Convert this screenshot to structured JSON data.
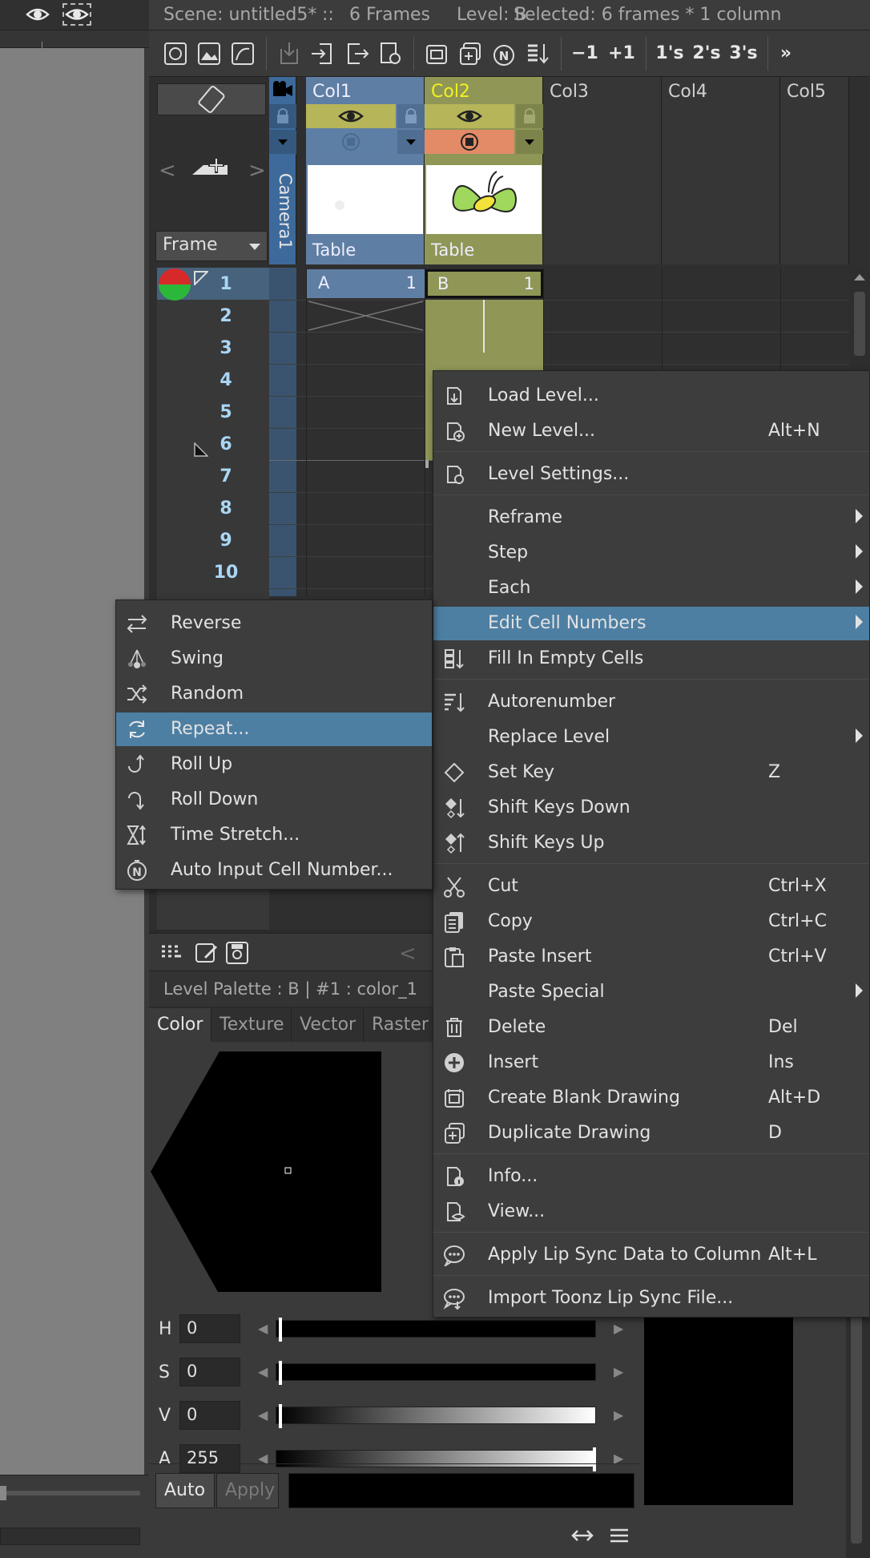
{
  "header": {
    "scene": "Scene: untitled5*",
    "sep": "::",
    "frames": "6 Frames",
    "level": "Level: B",
    "selected": "Selected: 6 frames * 1 column"
  },
  "toolbar": {
    "minus_one": "−1",
    "plus_one": "+1",
    "ones": "1's",
    "twos": "2's",
    "threes": "3's",
    "more": "»"
  },
  "xsheet": {
    "frame_dropdown": "Frame",
    "camera_label": "Camera1",
    "columns": [
      {
        "name": "Col1",
        "footer": "Table"
      },
      {
        "name": "Col2",
        "footer": "Table"
      },
      {
        "name": "Col3"
      },
      {
        "name": "Col4"
      },
      {
        "name": "Col5"
      }
    ],
    "rows": [
      "1",
      "2",
      "3",
      "4",
      "5",
      "6",
      "7",
      "8",
      "9",
      "10"
    ],
    "cell_col1": {
      "level": "A",
      "frame": "1"
    },
    "cell_col2": {
      "level": "B",
      "frame": "1"
    }
  },
  "palette": {
    "title": "Level Palette : B | #1 : color_1",
    "tabs": [
      "Color",
      "Texture",
      "Vector",
      "Raster"
    ],
    "hsva": [
      {
        "label": "H",
        "value": "0"
      },
      {
        "label": "S",
        "value": "0"
      },
      {
        "label": "V",
        "value": "0"
      },
      {
        "label": "A",
        "value": "255"
      }
    ],
    "auto_button": "Auto",
    "apply_button": "Apply"
  },
  "context_menu": {
    "items": [
      {
        "label": "Load Level...",
        "shortcut": ""
      },
      {
        "label": "New Level...",
        "shortcut": "Alt+N"
      },
      {
        "label": "Level Settings...",
        "shortcut": ""
      },
      {
        "label": "Reframe",
        "shortcut": ""
      },
      {
        "label": "Step",
        "shortcut": ""
      },
      {
        "label": "Each",
        "shortcut": ""
      },
      {
        "label": "Edit Cell Numbers",
        "shortcut": ""
      },
      {
        "label": "Fill In Empty Cells",
        "shortcut": ""
      },
      {
        "label": "Autorenumber",
        "shortcut": ""
      },
      {
        "label": "Replace Level",
        "shortcut": ""
      },
      {
        "label": "Set Key",
        "shortcut": "Z"
      },
      {
        "label": "Shift Keys Down",
        "shortcut": ""
      },
      {
        "label": "Shift Keys Up",
        "shortcut": ""
      },
      {
        "label": "Cut",
        "shortcut": "Ctrl+X"
      },
      {
        "label": "Copy",
        "shortcut": "Ctrl+C"
      },
      {
        "label": "Paste Insert",
        "shortcut": "Ctrl+V"
      },
      {
        "label": "Paste Special",
        "shortcut": ""
      },
      {
        "label": "Delete",
        "shortcut": "Del"
      },
      {
        "label": "Insert",
        "shortcut": "Ins"
      },
      {
        "label": "Create Blank Drawing",
        "shortcut": "Alt+D"
      },
      {
        "label": "Duplicate Drawing",
        "shortcut": "D"
      },
      {
        "label": "Info...",
        "shortcut": ""
      },
      {
        "label": "View...",
        "shortcut": ""
      },
      {
        "label": "Apply Lip Sync Data to Column",
        "shortcut": "Alt+L"
      },
      {
        "label": "Import Toonz Lip Sync File...",
        "shortcut": ""
      }
    ]
  },
  "submenu": {
    "items": [
      {
        "label": "Reverse"
      },
      {
        "label": "Swing"
      },
      {
        "label": "Random"
      },
      {
        "label": "Repeat..."
      },
      {
        "label": "Roll Up"
      },
      {
        "label": "Roll Down"
      },
      {
        "label": "Time Stretch..."
      },
      {
        "label": "Auto Input Cell Number..."
      }
    ]
  },
  "colors": {
    "highlight": "#4d7fa3",
    "col1": "#5f7ea3",
    "col2": "#8f9656",
    "row_number": "#a9d6f5"
  }
}
